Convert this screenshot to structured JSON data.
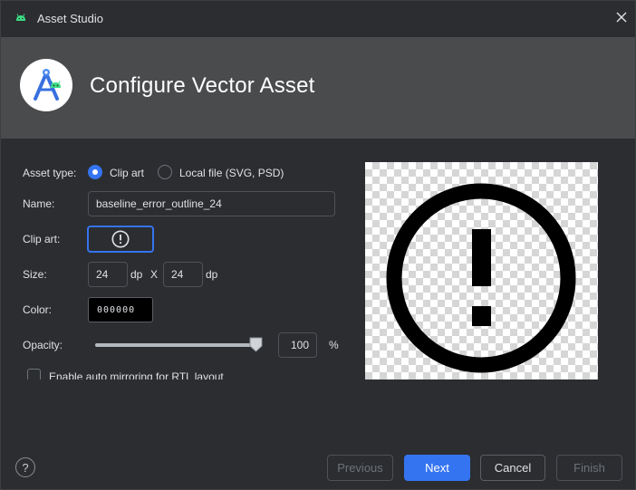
{
  "window": {
    "title": "Asset Studio",
    "icon": "android-icon",
    "close_icon": "close-icon"
  },
  "header": {
    "title": "Configure Vector Asset",
    "logo": "android-studio-logo"
  },
  "form": {
    "asset_type_label": "Asset type:",
    "asset_type_options": [
      {
        "label": "Clip art",
        "selected": true
      },
      {
        "label": "Local file (SVG, PSD)",
        "selected": false
      }
    ],
    "name_label": "Name:",
    "name_value": "baseline_error_outline_24",
    "clip_art_label": "Clip art:",
    "clip_art_icon": "error-outline-icon",
    "size_label": "Size:",
    "size_width": "24",
    "size_unit_1": "dp",
    "size_separator": "X",
    "size_height": "24",
    "size_unit_2": "dp",
    "color_label": "Color:",
    "color_value": "000000",
    "opacity_label": "Opacity:",
    "opacity_value": "100",
    "opacity_unit": "%",
    "opacity_fraction": 1.0,
    "auto_mirror_label": "Enable auto mirroring for RTL layout",
    "auto_mirror_checked": false
  },
  "preview": {
    "icon": "error-outline-icon",
    "background": "checkerboard"
  },
  "footer": {
    "help_label": "?",
    "previous_label": "Previous",
    "next_label": "Next",
    "cancel_label": "Cancel",
    "finish_label": "Finish"
  },
  "colors": {
    "accent": "#3574f0",
    "background": "#2b2d30",
    "header": "#4a4b4d"
  }
}
